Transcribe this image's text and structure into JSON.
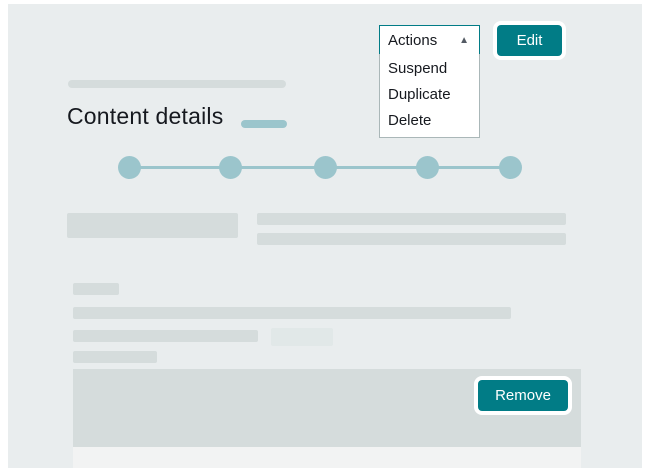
{
  "page": {
    "title": "Content details"
  },
  "actions": {
    "label": "Actions",
    "menu": [
      {
        "label": "Suspend"
      },
      {
        "label": "Duplicate"
      },
      {
        "label": "Delete"
      }
    ]
  },
  "buttons": {
    "edit": "Edit",
    "remove": "Remove"
  },
  "stepper": {
    "steps": 5
  },
  "colors": {
    "accent": "#017c86",
    "stepper": "#9bc5cc",
    "placeholder": "#d5dcdc",
    "background": "#e9edee"
  }
}
